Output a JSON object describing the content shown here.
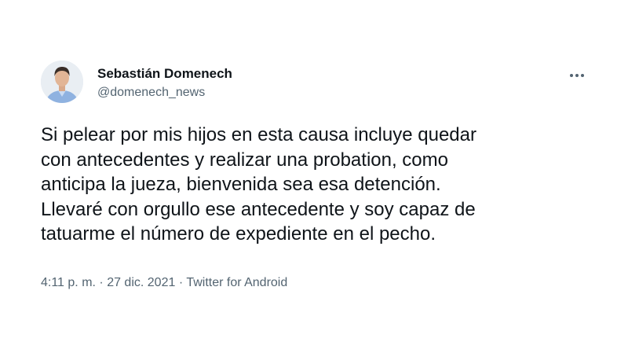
{
  "author": {
    "name": "Sebastián Domenech",
    "handle": "@domenech_news"
  },
  "icons": {
    "more": "more-horizontal-icon",
    "avatar": "profile-photo"
  },
  "tweet": {
    "lines": [
      "Si pelear por mis hijos en esta causa incluye quedar",
      "con antecedentes y realizar una probation, como",
      "anticipa la jueza, bienvenida sea esa detención.",
      "Llevaré con orgullo ese antecedente y soy capaz de",
      "tatuarme el número de expediente en el pecho."
    ]
  },
  "meta": {
    "time": "4:11 p. m.",
    "separator": " · ",
    "date": "27 dic. 2021",
    "source": "Twitter for Android"
  },
  "colors": {
    "text": "#0f1419",
    "secondary": "#536471",
    "background": "#ffffff"
  }
}
